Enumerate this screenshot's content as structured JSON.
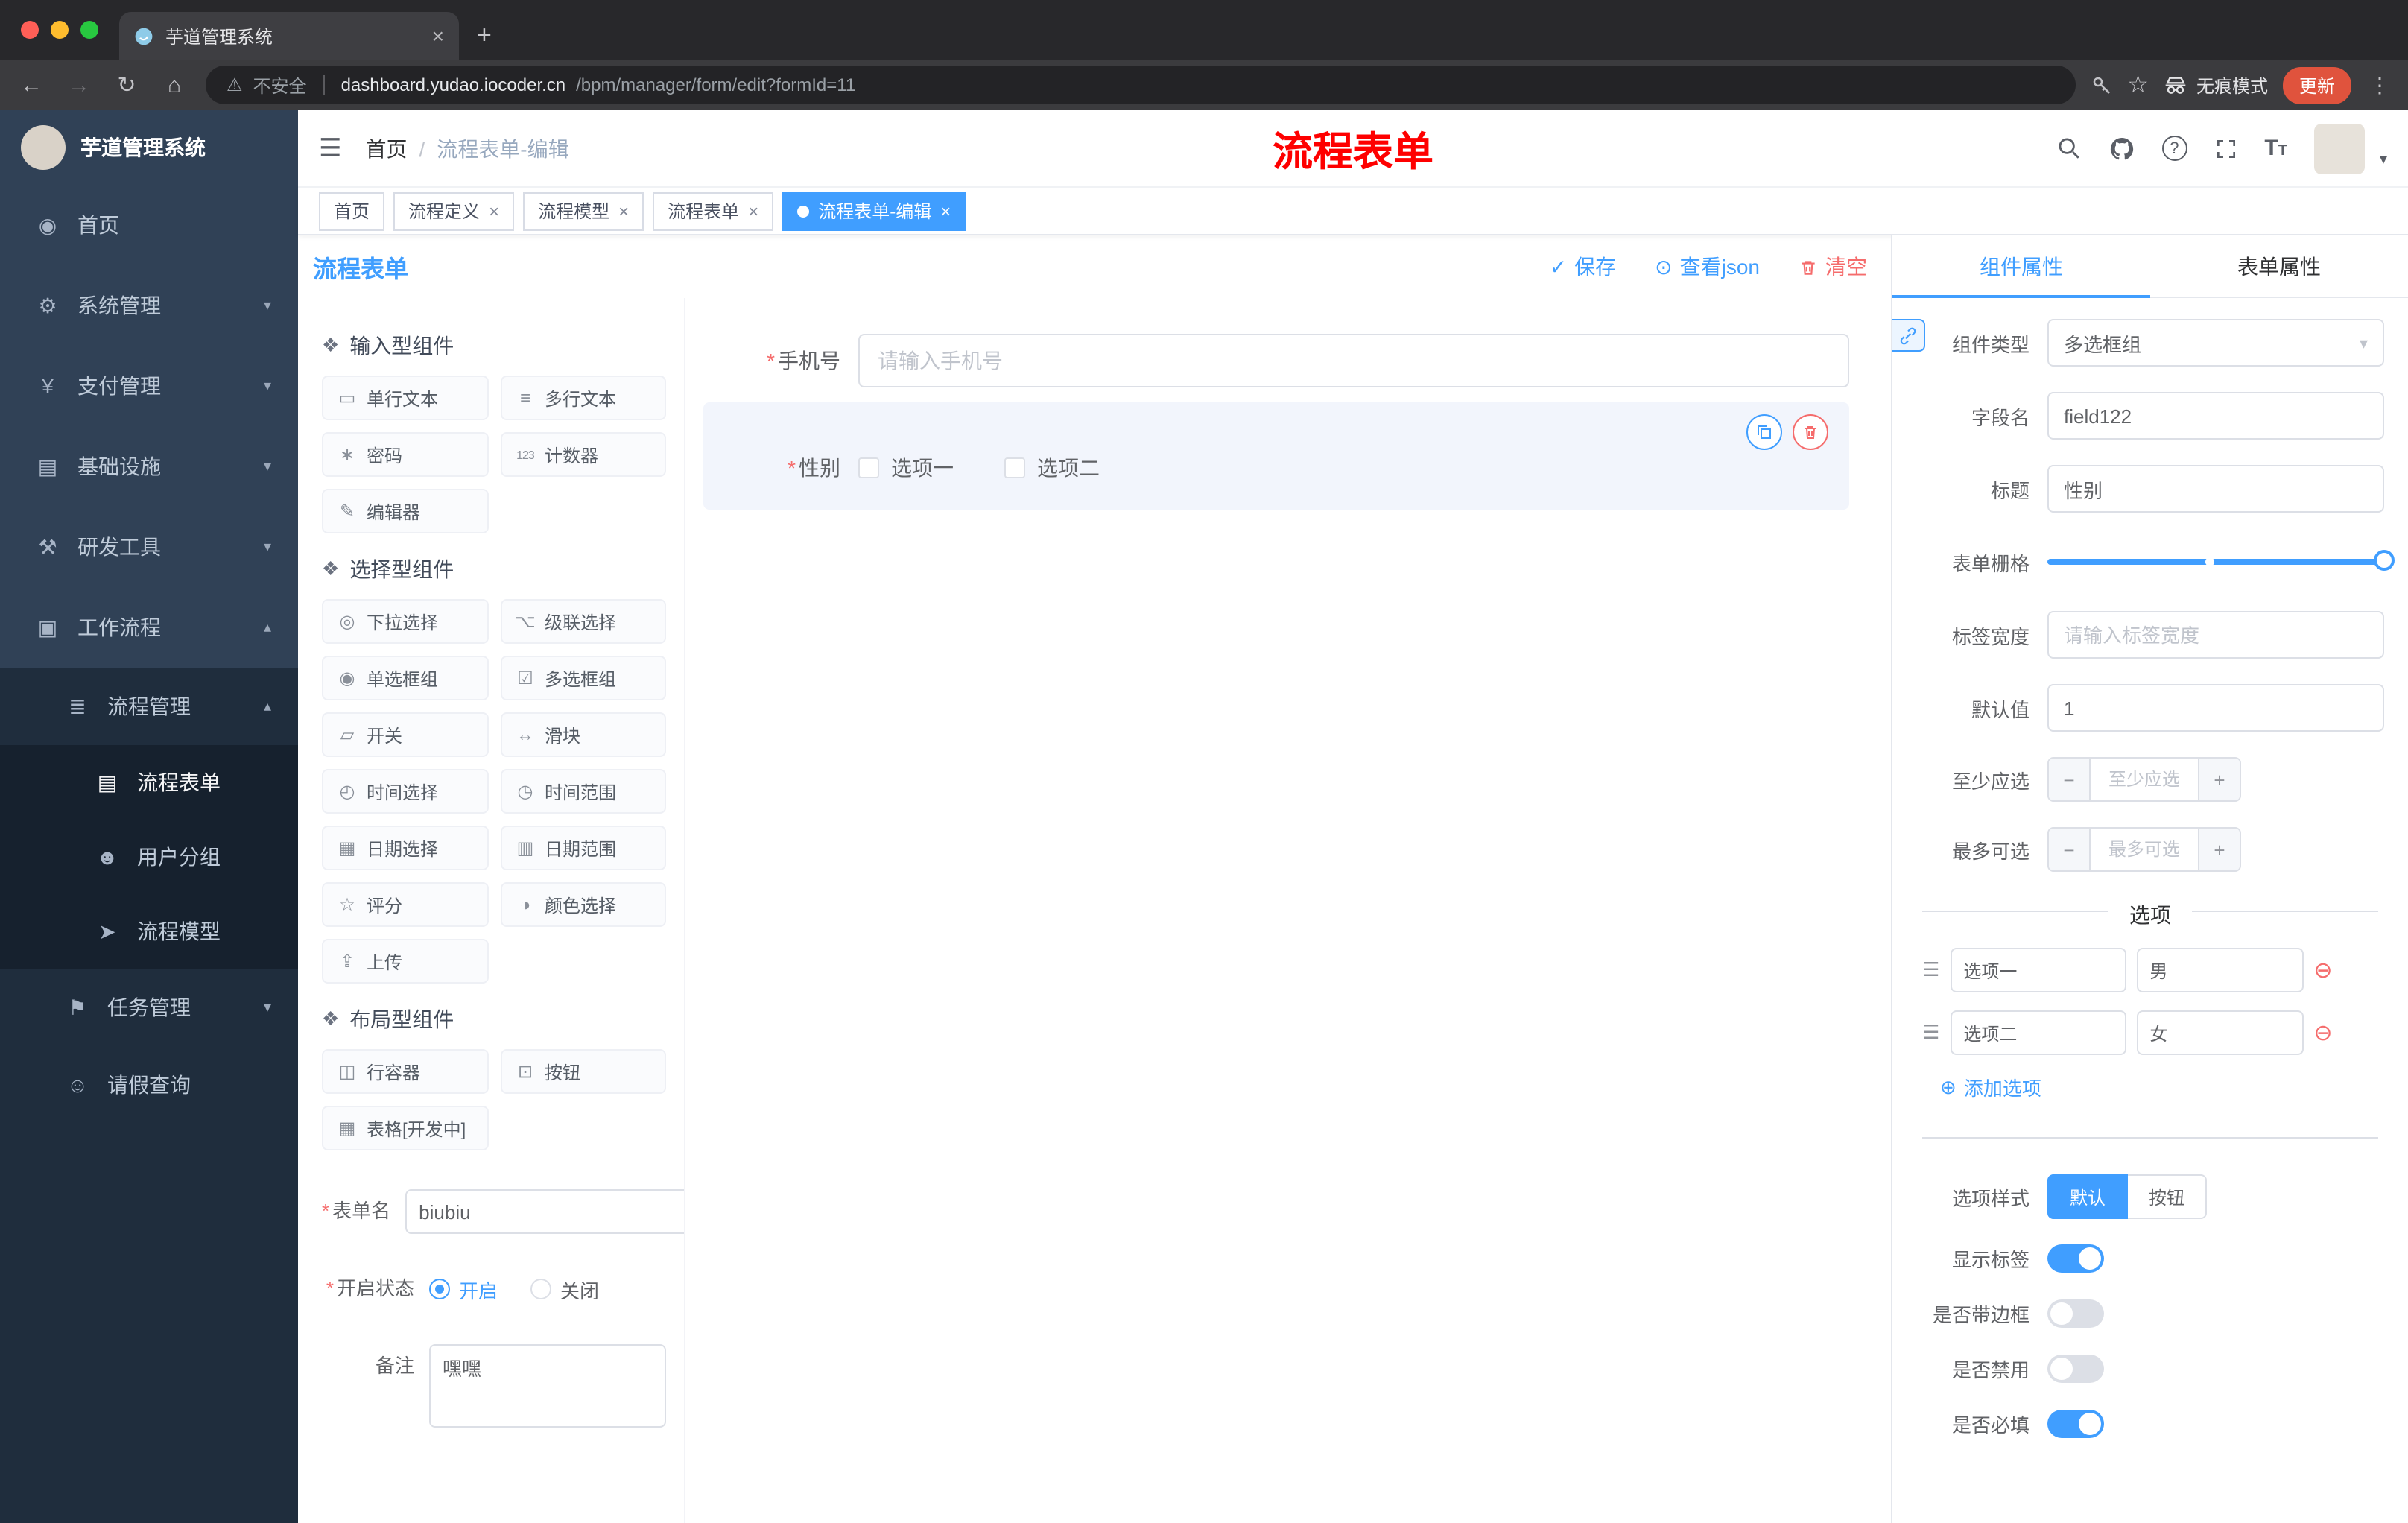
{
  "colors": {
    "accent": "#409eff",
    "danger": "#f56c6c"
  },
  "icons": {
    "hamburger": "☰",
    "sep": "/",
    "back": "←",
    "forward": "→",
    "reload": "↻",
    "home": "⌂",
    "warning": "⚠",
    "star": "☆",
    "dots": "⋮",
    "plus": "+",
    "close": "×",
    "dashboard": "◉",
    "gear": "⚙",
    "payment": "¥",
    "infra": "▤",
    "tools": "⚒",
    "workflow": "▣",
    "process": "≣",
    "form": "▤",
    "users": "☻",
    "model": "➤",
    "task": "⚑",
    "person": "☺",
    "chev_down": "▾",
    "chev_up": "▴",
    "check": "✓",
    "eye": "⊙",
    "cube": "❖",
    "caret": "▾",
    "minus": "−",
    "plus_s": "+",
    "add": "⊕",
    "remove": "⊖",
    "sliders": "☰",
    "dot": "●",
    "tsize_big": "T",
    "tsize_small": "T"
  },
  "browser": {
    "tab_title": "芋道管理系统",
    "security": "不安全",
    "url_host": "dashboard.yudao.iocoder.cn",
    "url_path": "/bpm/manager/form/edit?formId=11",
    "incognito": "无痕模式",
    "update": "更新"
  },
  "sidebar": {
    "logo": "芋道管理系统",
    "items": [
      {
        "label": "首页"
      },
      {
        "label": "系统管理"
      },
      {
        "label": "支付管理"
      },
      {
        "label": "基础设施"
      },
      {
        "label": "研发工具"
      },
      {
        "label": "工作流程"
      },
      {
        "label": "流程管理"
      },
      {
        "label": "流程表单"
      },
      {
        "label": "用户分组"
      },
      {
        "label": "流程模型"
      },
      {
        "label": "任务管理"
      },
      {
        "label": "请假查询"
      }
    ]
  },
  "header": {
    "breadcrumb_home": "首页",
    "breadcrumb_current": "流程表单-编辑",
    "annotation": "流程表单"
  },
  "tags": [
    {
      "label": "首页"
    },
    {
      "label": "流程定义"
    },
    {
      "label": "流程模型"
    },
    {
      "label": "流程表单"
    },
    {
      "label": "流程表单-编辑"
    }
  ],
  "designer": {
    "title": "流程表单",
    "save": "保存",
    "view_json": "查看json",
    "clear": "清空",
    "palette": {
      "sections": [
        {
          "title": "输入型组件",
          "items": [
            {
              "label": "单行文本",
              "icon": "▭"
            },
            {
              "label": "多行文本",
              "icon": "≡"
            },
            {
              "label": "密码",
              "icon": "∗"
            },
            {
              "label": "计数器",
              "icon": "123"
            },
            {
              "label": "编辑器",
              "icon": "✎"
            }
          ]
        },
        {
          "title": "选择型组件",
          "items": [
            {
              "label": "下拉选择",
              "icon": "◎"
            },
            {
              "label": "级联选择",
              "icon": "⌥"
            },
            {
              "label": "单选框组",
              "icon": "◉"
            },
            {
              "label": "多选框组",
              "icon": "☑"
            },
            {
              "label": "开关",
              "icon": "▱"
            },
            {
              "label": "滑块",
              "icon": "↔"
            },
            {
              "label": "时间选择",
              "icon": "◴"
            },
            {
              "label": "时间范围",
              "icon": "◷"
            },
            {
              "label": "日期选择",
              "icon": "▦"
            },
            {
              "label": "日期范围",
              "icon": "▥"
            },
            {
              "label": "评分",
              "icon": "☆"
            },
            {
              "label": "颜色选择",
              "icon": "◑"
            },
            {
              "label": "上传",
              "icon": "⇪"
            }
          ]
        },
        {
          "title": "布局型组件",
          "items": [
            {
              "label": "行容器",
              "icon": "◫"
            },
            {
              "label": "按钮",
              "icon": "⊡"
            },
            {
              "label": "表格[开发中]",
              "icon": "▦"
            }
          ]
        }
      ]
    },
    "meta": {
      "name_label": "表单名",
      "name_value": "biubiu",
      "status_label": "开启状态",
      "status_on": "开启",
      "status_off": "关闭",
      "remark_label": "备注",
      "remark_value": "嘿嘿"
    },
    "canvas": {
      "phone_label": "手机号",
      "phone_placeholder": "请输入手机号",
      "gender_label": "性别",
      "gender_opt1": "选项一",
      "gender_opt2": "选项二"
    }
  },
  "props": {
    "tab_component": "组件属性",
    "tab_form": "表单属性",
    "type_label": "组件类型",
    "type_value": "多选框组",
    "field_label": "字段名",
    "field_value": "field122",
    "title_label": "标题",
    "title_value": "性别",
    "grid_label": "表单栅格",
    "label_width_label": "标签宽度",
    "label_width_placeholder": "请输入标签宽度",
    "default_label": "默认值",
    "default_value": "1",
    "min_label": "至少应选",
    "min_placeholder": "至少应选",
    "max_label": "最多可选",
    "max_placeholder": "最多可选",
    "options_title": "选项",
    "options": [
      {
        "label": "选项一",
        "value": "男"
      },
      {
        "label": "选项二",
        "value": "女"
      }
    ],
    "add_option": "添加选项",
    "style_label": "选项样式",
    "style_default": "默认",
    "style_button": "按钮",
    "show_label": "显示标签",
    "border_label": "是否带边框",
    "disabled_label": "是否禁用",
    "required_label": "是否必填"
  }
}
